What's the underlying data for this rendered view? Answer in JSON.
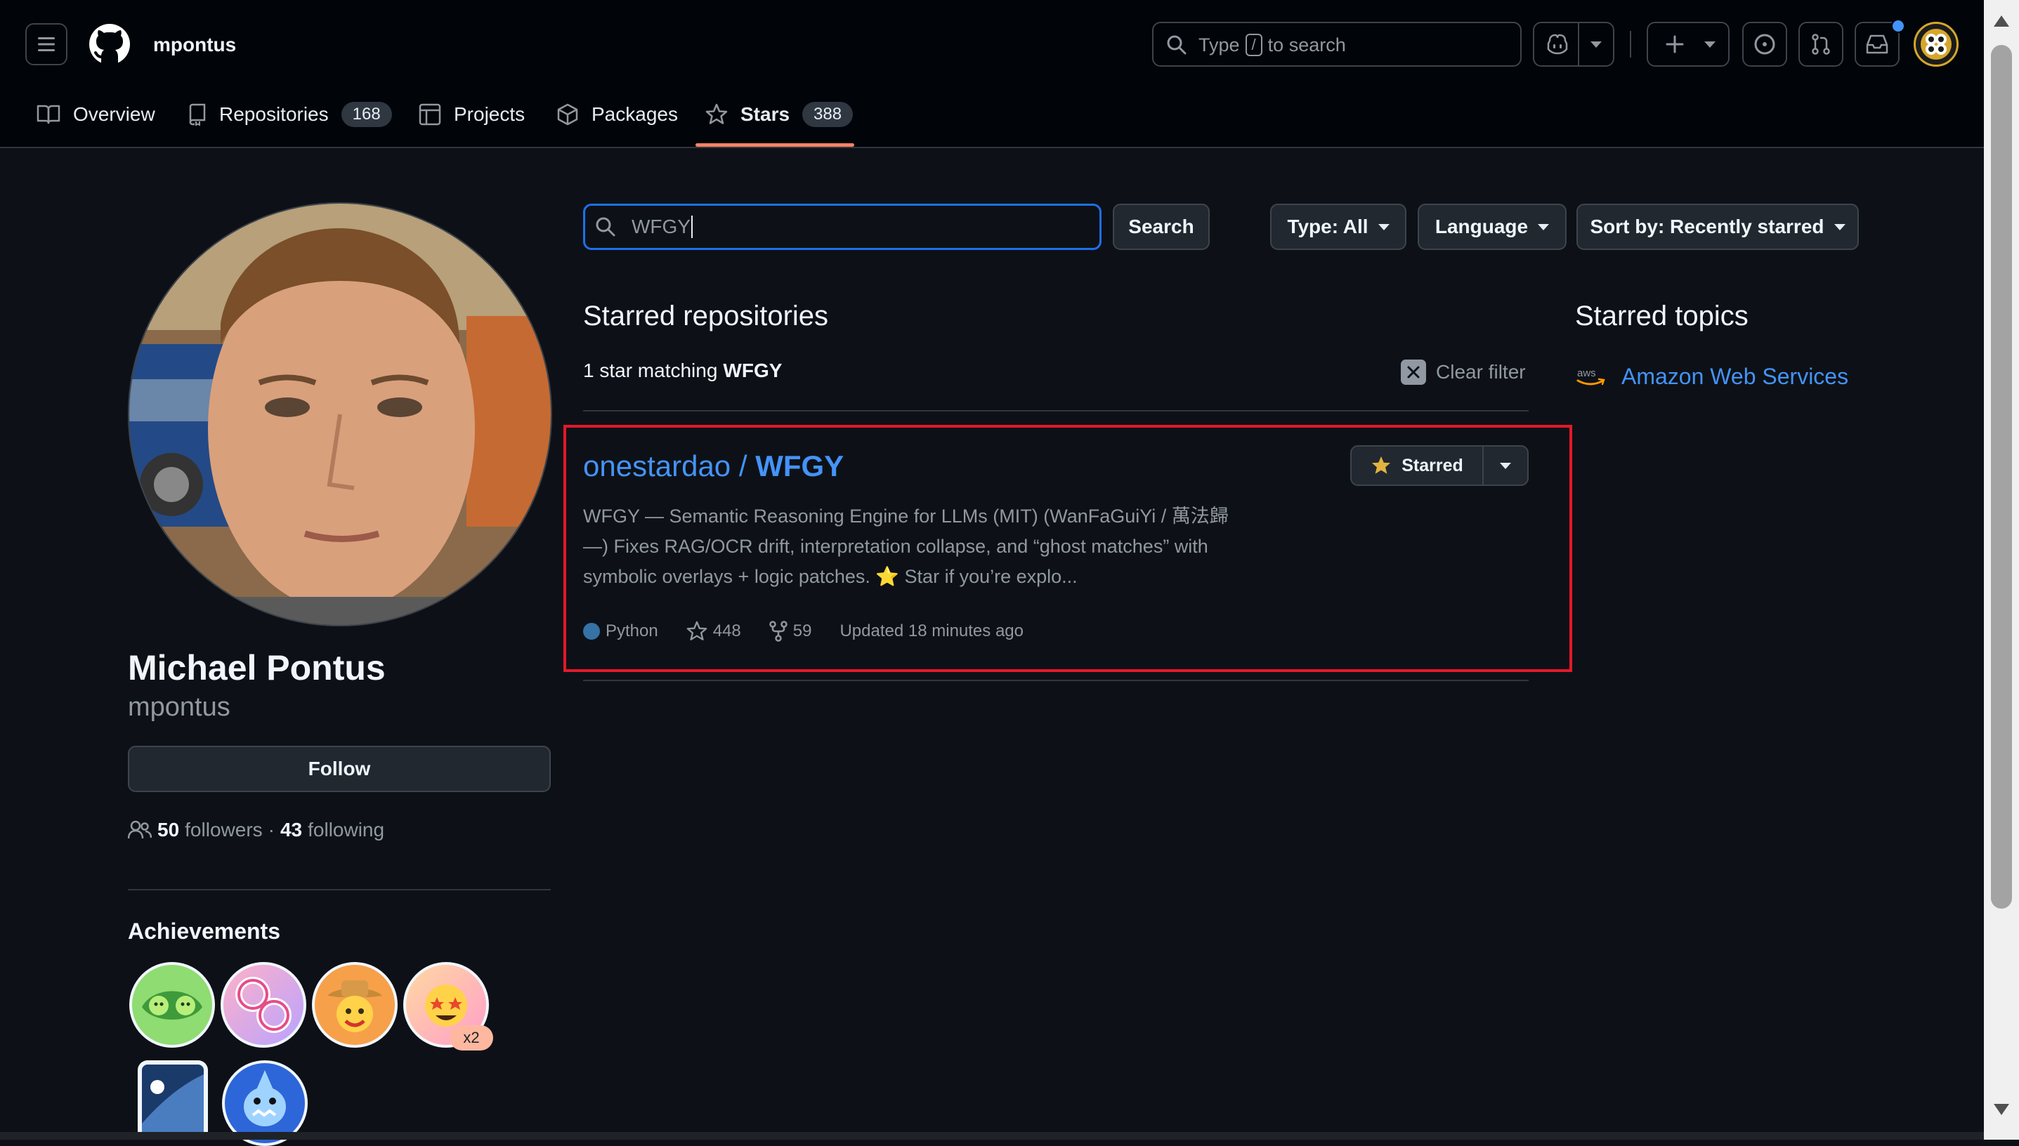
{
  "header": {
    "username": "mpontus",
    "search_placeholder_before": "Type",
    "search_key": "/",
    "search_placeholder_after": "to search"
  },
  "tabs": [
    {
      "label": "Overview"
    },
    {
      "label": "Repositories",
      "count": "168"
    },
    {
      "label": "Projects"
    },
    {
      "label": "Packages"
    },
    {
      "label": "Stars",
      "count": "388"
    }
  ],
  "profile": {
    "name": "Michael Pontus",
    "login": "mpontus",
    "follow_label": "Follow",
    "followers_count": "50",
    "followers_label": "followers",
    "separator": "·",
    "following_count": "43",
    "following_label": "following",
    "achievements_heading": "Achievements",
    "achievement_badge": "x2"
  },
  "filters": {
    "search_value": "WFGY",
    "search_button": "Search",
    "type_label": "Type: All",
    "language_label": "Language",
    "sort_label": "Sort by: Recently starred"
  },
  "starred": {
    "heading": "Starred repositories",
    "match_prefix": "1 star matching",
    "match_term": "WFGY",
    "clear_filter": "Clear filter"
  },
  "repo": {
    "owner": "onestardao",
    "separator": " / ",
    "name": "WFGY",
    "starred_label": "Starred",
    "description_line1": "WFGY — Semantic Reasoning Engine for LLMs (MIT) (WanFaGuiYi / 萬法歸",
    "description_line2": "—) Fixes RAG/OCR drift, interpretation collapse, and “ghost matches” with",
    "description_line3": "symbolic overlays + logic patches. ⭐ Star if you’re explo...",
    "language": "Python",
    "language_color": "#3572A5",
    "stars": "448",
    "forks": "59",
    "updated": "Updated 18 minutes ago"
  },
  "topics": {
    "heading": "Starred topics",
    "items": [
      {
        "label": "Amazon Web Services",
        "icon": "aws-icon"
      }
    ]
  },
  "colors": {
    "background": "#0d1117",
    "header_bg": "#010409",
    "link": "#4493f8",
    "highlight_box": "#e5182a",
    "tab_underline": "#f78166",
    "star": "#e3b341"
  }
}
